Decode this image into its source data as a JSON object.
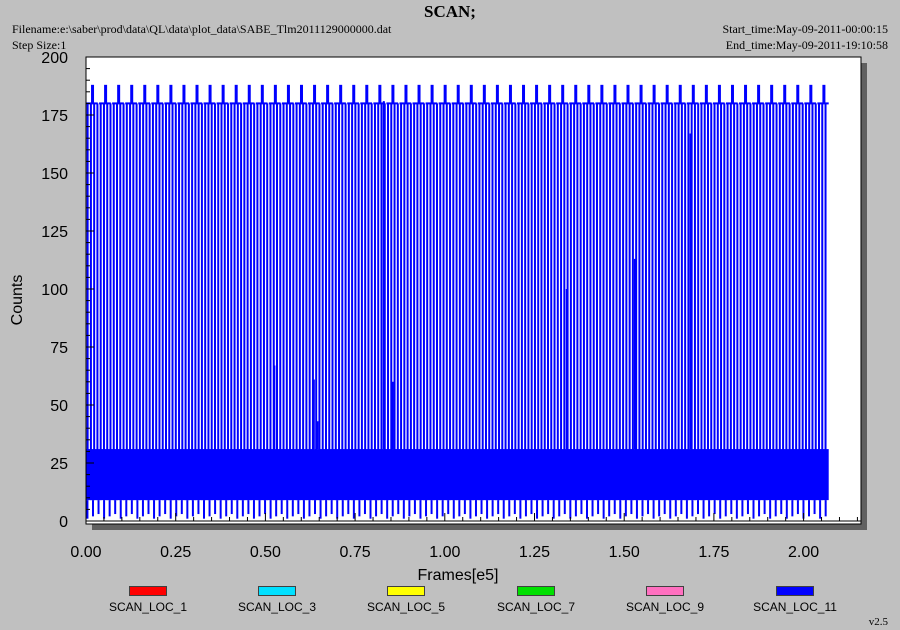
{
  "header": {
    "title": "SCAN;",
    "filename": "Filename:e:\\saber\\prod\\data\\QL\\data\\plot_data\\SABE_Tlm2011129000000.dat",
    "step_size": "Step Size:1",
    "start_time": "Start_time:May-09-2011-00:00:15",
    "end_time": "End_time:May-09-2011-19:10:58"
  },
  "version": "v2.5",
  "colors": {
    "background": "#c0c0c0",
    "plot_area": "#ffffff",
    "shadow": "#606060",
    "series_main": "#0000ff"
  },
  "chart_data": {
    "type": "line",
    "xlabel": "Frames[e5]",
    "ylabel": "Counts",
    "xlim": [
      0,
      2.16
    ],
    "ylim": [
      0,
      200
    ],
    "x_ticks": [
      "0.00",
      "0.25",
      "0.50",
      "0.75",
      "1.00",
      "1.25",
      "1.50",
      "1.75",
      "2.00"
    ],
    "y_ticks": [
      "0",
      "25",
      "50",
      "75",
      "100",
      "125",
      "150",
      "175",
      "200"
    ],
    "x_range": [
      0.0,
      2.07
    ],
    "grid": false,
    "legend_position": "bottom",
    "series": [
      {
        "name": "SCAN_LOC_1",
        "color": "#ff0000"
      },
      {
        "name": "SCAN_LOC_3",
        "color": "#00e0ff"
      },
      {
        "name": "SCAN_LOC_5",
        "color": "#ffff00"
      },
      {
        "name": "SCAN_LOC_7",
        "color": "#00e000"
      },
      {
        "name": "SCAN_LOC_9",
        "color": "#ff70c0"
      },
      {
        "name": "SCAN_LOC_11",
        "color": "#0000ff",
        "band_range": [
          9,
          31
        ],
        "low_points": [
          1,
          2,
          3
        ],
        "top_level": 180,
        "peak_level": 188,
        "peak_spacing": 0.0364,
        "spike_spacing": 0.0091,
        "inner_spikes": [
          {
            "x": 0.525,
            "y": 67
          },
          {
            "x": 0.635,
            "y": 61
          },
          {
            "x": 0.645,
            "y": 43
          },
          {
            "x": 0.83,
            "y": 181
          },
          {
            "x": 0.855,
            "y": 60
          },
          {
            "x": 1.34,
            "y": 100
          },
          {
            "x": 1.53,
            "y": 113
          },
          {
            "x": 1.685,
            "y": 167
          },
          {
            "x": 1.88,
            "y": 26
          }
        ]
      }
    ]
  }
}
